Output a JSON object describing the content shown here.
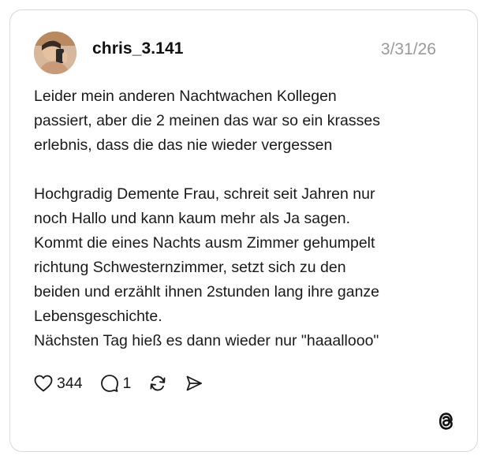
{
  "post": {
    "username": "chris_3.141",
    "date": "3/31/26",
    "paragraph1": "Leider mein anderen Nachtwachen Kollegen\npassiert, aber die 2 meinen das war so ein krasses\nerlebnis, dass die das nie wieder vergessen",
    "paragraph2": "Hochgradig Demente Frau, schreit seit Jahren nur\nnoch Hallo und kann kaum mehr als Ja sagen.\nKommt die eines Nachts ausm Zimmer gehumpelt\nrichtung Schwesternzimmer, setzt sich zu den\nbeiden und erzählt ihnen 2stunden lang ihre ganze\nLebensgeschichte.\nNächsten Tag hieß es dann wieder nur \"haaallooo\""
  },
  "actions": {
    "likes": "344",
    "replies": "1",
    "like_icon": "heart-icon",
    "reply_icon": "speech-bubble-icon",
    "repost_icon": "repost-icon",
    "share_icon": "send-icon"
  },
  "branding": {
    "logo_icon": "threads-logo-icon"
  },
  "colors": {
    "text": "#1a1a1a",
    "muted": "#9a9a9a",
    "border": "#d9d9d9"
  }
}
